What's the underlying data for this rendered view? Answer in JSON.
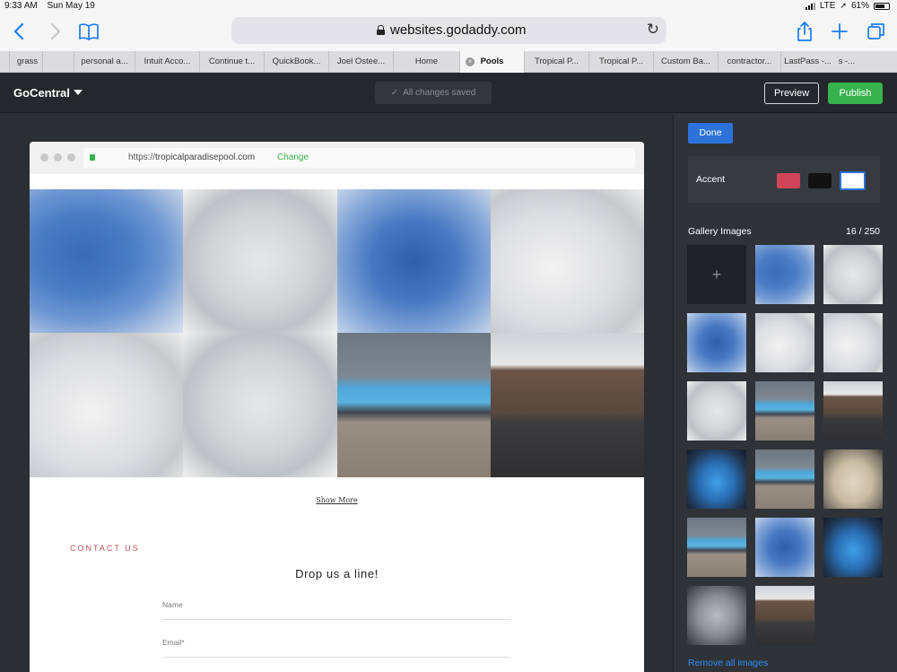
{
  "status_bar": {
    "time": "9:33 AM",
    "date": "Sun May 19",
    "network": "LTE",
    "battery": "61%"
  },
  "browser": {
    "url": "websites.godaddy.com",
    "icons": [
      "back-chevron-icon",
      "forward-chevron-icon",
      "bookmarks-book-icon",
      "reload-icon",
      "share-icon",
      "new-tab-plus-icon",
      "tabs-icon"
    ],
    "tabs": [
      {
        "label": "grass"
      },
      {
        "label": "personal a..."
      },
      {
        "label": "Intuit Acco..."
      },
      {
        "label": "Continue t..."
      },
      {
        "label": "QuickBook..."
      },
      {
        "label": "Joel Ostee..."
      },
      {
        "label": "Home"
      },
      {
        "label": "Pools",
        "active": true
      },
      {
        "label": "Tropical P..."
      },
      {
        "label": "Tropical P..."
      },
      {
        "label": "Custom Ba..."
      },
      {
        "label": "contractor..."
      },
      {
        "label": "LastPass -..."
      },
      {
        "label": "s -..."
      }
    ]
  },
  "editor": {
    "brand": "GoCentral",
    "saved_status": "All changes saved",
    "preview_label": "Preview",
    "publish_label": "Publish",
    "publish_color": "#37b24d"
  },
  "preview": {
    "site_url_prefix": "https://",
    "site_domain": "tropicalparadisepool.com",
    "change_label": "Change",
    "gallery": [
      {
        "desc": "blue-spa"
      },
      {
        "desc": "white-spa"
      },
      {
        "desc": "blue-spa"
      },
      {
        "desc": "white-swim-spa"
      },
      {
        "desc": "white-swim-spa"
      },
      {
        "desc": "white-swim-spa"
      },
      {
        "desc": "swim-spa-on-pavers"
      },
      {
        "desc": "swim-spa-wood-cabinet"
      }
    ],
    "show_more": "Show More",
    "contact_label": "CONTACT US",
    "contact_title": "Drop us a line!",
    "name_field": "Name",
    "email_field": "Email*"
  },
  "sidebar": {
    "done_label": "Done",
    "accent_label": "Accent",
    "accent_colors": [
      "#d04658",
      "#121212",
      "#ffffff"
    ],
    "selected_accent": "#ffffff",
    "gallery_title": "Gallery Images",
    "gallery_count": "16 / 250",
    "add_symbol": "+",
    "remove_all": "Remove all images"
  }
}
